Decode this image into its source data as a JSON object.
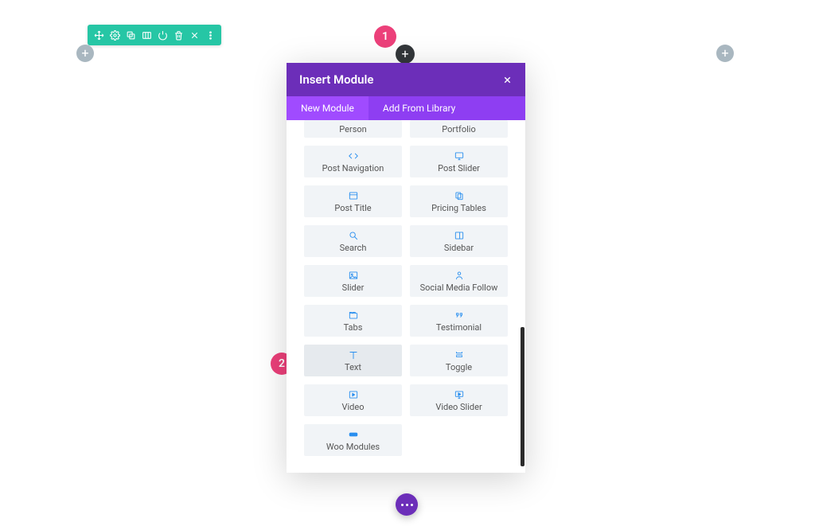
{
  "toolbar_icons": [
    "move",
    "settings",
    "duplicate",
    "columns",
    "power",
    "trash",
    "close",
    "more"
  ],
  "modal": {
    "title": "Insert Module",
    "tabs": {
      "new": "New Module",
      "library": "Add From Library"
    }
  },
  "badges": {
    "one": "1",
    "two": "2"
  },
  "modules": {
    "person": "Person",
    "portfolio": "Portfolio",
    "post_navigation": "Post Navigation",
    "post_slider": "Post Slider",
    "post_title": "Post Title",
    "pricing_tables": "Pricing Tables",
    "search": "Search",
    "sidebar": "Sidebar",
    "slider": "Slider",
    "social_media_follow": "Social Media Follow",
    "tabs": "Tabs",
    "testimonial": "Testimonial",
    "text": "Text",
    "toggle": "Toggle",
    "video": "Video",
    "video_slider": "Video Slider",
    "woo_modules": "Woo Modules"
  }
}
